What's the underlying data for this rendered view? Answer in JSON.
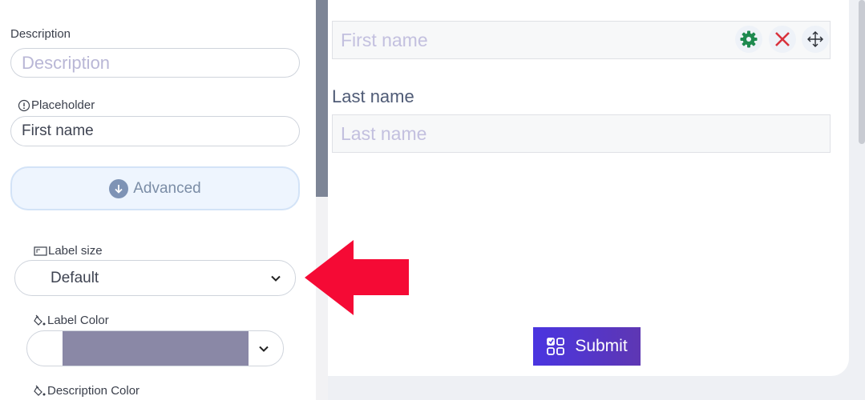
{
  "settings": {
    "description_label": "Description",
    "description_placeholder": "Description",
    "placeholder_label": "Placeholder",
    "placeholder_value": "First name",
    "advanced_button": "Advanced",
    "label_size_label": "Label size",
    "label_size_value": "Default",
    "label_color_label": "Label Color",
    "label_color_value": "#8a88a6",
    "description_color_label": "Description Color"
  },
  "form": {
    "first_name_placeholder": "First name",
    "last_name_label": "Last name",
    "last_name_placeholder": "Last name",
    "submit_label": "Submit"
  },
  "icons": {
    "settings": "gear-icon",
    "delete": "close-icon",
    "move": "move-icon",
    "submit": "apps-check-icon",
    "advanced": "arrow-down-circle-icon",
    "placeholder": "info-circle-icon",
    "label_size": "resize-icon",
    "label_color": "paint-bucket-icon"
  },
  "colors": {
    "accent": "#4a35e0",
    "arrow": "#f50a35",
    "gear": "#1e8a4f",
    "close": "#d9313c"
  }
}
